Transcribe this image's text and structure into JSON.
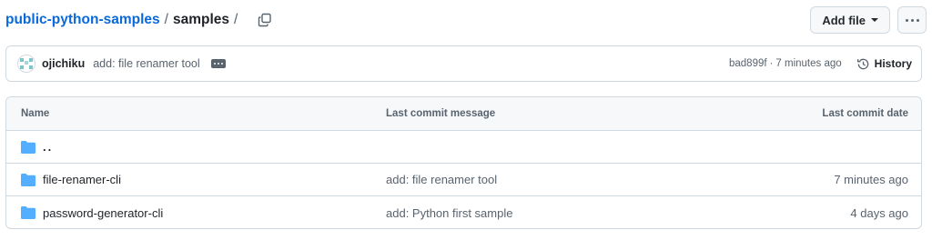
{
  "breadcrumb": {
    "repo": "public-python-samples",
    "separator": "/",
    "current": "samples",
    "trailing_separator": "/"
  },
  "actions": {
    "add_file_label": "Add file"
  },
  "latest_commit": {
    "author": "ojichiku",
    "message": "add: file renamer tool",
    "sha": "bad899f",
    "separator": "·",
    "time": "7 minutes ago",
    "history_label": "History"
  },
  "table": {
    "headers": {
      "name": "Name",
      "message": "Last commit message",
      "date": "Last commit date"
    },
    "parent": "..",
    "rows": [
      {
        "name": "file-renamer-cli",
        "message": "add: file renamer tool",
        "date": "7 minutes ago"
      },
      {
        "name": "password-generator-cli",
        "message": "add: Python first sample",
        "date": "4 days ago"
      }
    ]
  },
  "colors": {
    "link": "#0969da",
    "folder": "#54aeff",
    "muted": "#59636e",
    "border": "#d1d9e0"
  }
}
